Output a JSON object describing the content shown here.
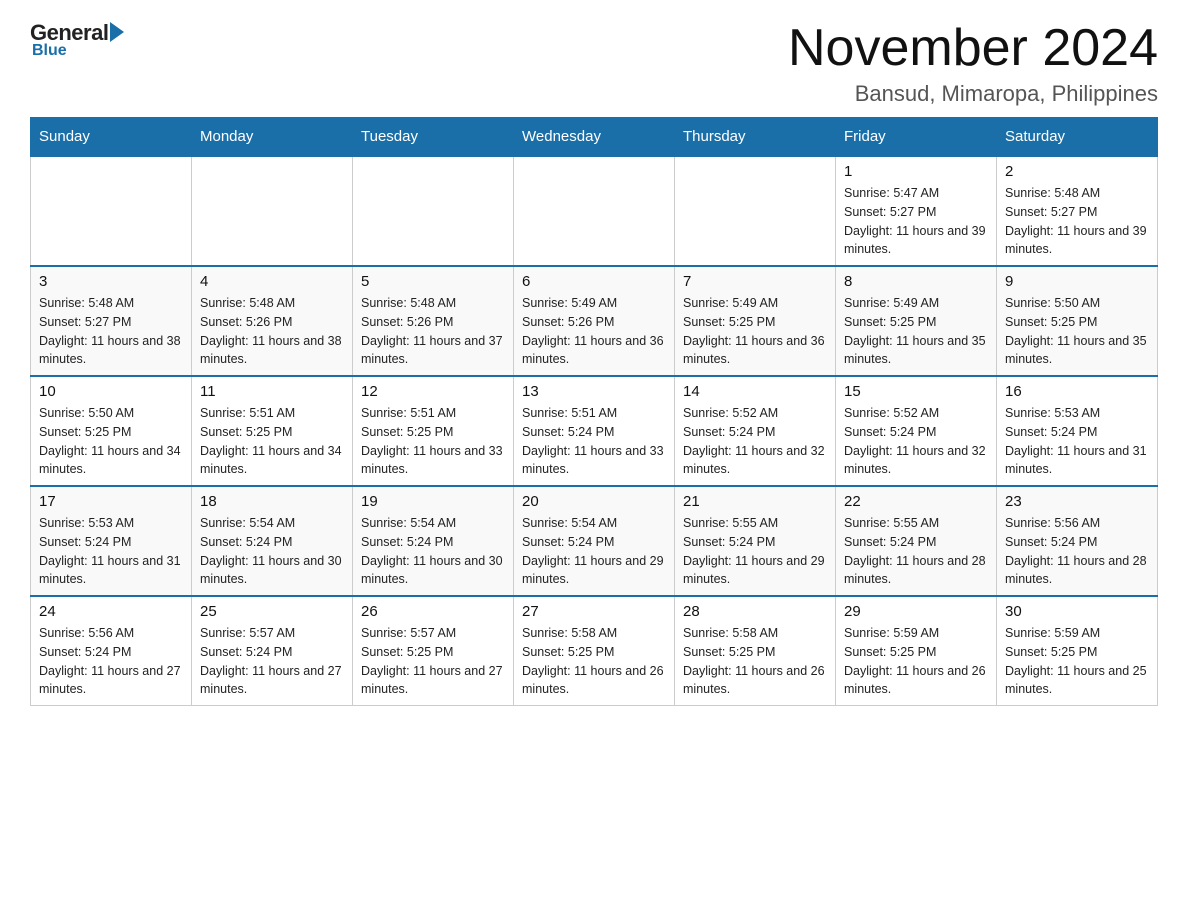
{
  "logo": {
    "general": "General",
    "blue": "Blue"
  },
  "title": "November 2024",
  "subtitle": "Bansud, Mimaropa, Philippines",
  "days_of_week": [
    "Sunday",
    "Monday",
    "Tuesday",
    "Wednesday",
    "Thursday",
    "Friday",
    "Saturday"
  ],
  "weeks": [
    [
      {
        "day": "",
        "info": ""
      },
      {
        "day": "",
        "info": ""
      },
      {
        "day": "",
        "info": ""
      },
      {
        "day": "",
        "info": ""
      },
      {
        "day": "",
        "info": ""
      },
      {
        "day": "1",
        "info": "Sunrise: 5:47 AM\nSunset: 5:27 PM\nDaylight: 11 hours and 39 minutes."
      },
      {
        "day": "2",
        "info": "Sunrise: 5:48 AM\nSunset: 5:27 PM\nDaylight: 11 hours and 39 minutes."
      }
    ],
    [
      {
        "day": "3",
        "info": "Sunrise: 5:48 AM\nSunset: 5:27 PM\nDaylight: 11 hours and 38 minutes."
      },
      {
        "day": "4",
        "info": "Sunrise: 5:48 AM\nSunset: 5:26 PM\nDaylight: 11 hours and 38 minutes."
      },
      {
        "day": "5",
        "info": "Sunrise: 5:48 AM\nSunset: 5:26 PM\nDaylight: 11 hours and 37 minutes."
      },
      {
        "day": "6",
        "info": "Sunrise: 5:49 AM\nSunset: 5:26 PM\nDaylight: 11 hours and 36 minutes."
      },
      {
        "day": "7",
        "info": "Sunrise: 5:49 AM\nSunset: 5:25 PM\nDaylight: 11 hours and 36 minutes."
      },
      {
        "day": "8",
        "info": "Sunrise: 5:49 AM\nSunset: 5:25 PM\nDaylight: 11 hours and 35 minutes."
      },
      {
        "day": "9",
        "info": "Sunrise: 5:50 AM\nSunset: 5:25 PM\nDaylight: 11 hours and 35 minutes."
      }
    ],
    [
      {
        "day": "10",
        "info": "Sunrise: 5:50 AM\nSunset: 5:25 PM\nDaylight: 11 hours and 34 minutes."
      },
      {
        "day": "11",
        "info": "Sunrise: 5:51 AM\nSunset: 5:25 PM\nDaylight: 11 hours and 34 minutes."
      },
      {
        "day": "12",
        "info": "Sunrise: 5:51 AM\nSunset: 5:25 PM\nDaylight: 11 hours and 33 minutes."
      },
      {
        "day": "13",
        "info": "Sunrise: 5:51 AM\nSunset: 5:24 PM\nDaylight: 11 hours and 33 minutes."
      },
      {
        "day": "14",
        "info": "Sunrise: 5:52 AM\nSunset: 5:24 PM\nDaylight: 11 hours and 32 minutes."
      },
      {
        "day": "15",
        "info": "Sunrise: 5:52 AM\nSunset: 5:24 PM\nDaylight: 11 hours and 32 minutes."
      },
      {
        "day": "16",
        "info": "Sunrise: 5:53 AM\nSunset: 5:24 PM\nDaylight: 11 hours and 31 minutes."
      }
    ],
    [
      {
        "day": "17",
        "info": "Sunrise: 5:53 AM\nSunset: 5:24 PM\nDaylight: 11 hours and 31 minutes."
      },
      {
        "day": "18",
        "info": "Sunrise: 5:54 AM\nSunset: 5:24 PM\nDaylight: 11 hours and 30 minutes."
      },
      {
        "day": "19",
        "info": "Sunrise: 5:54 AM\nSunset: 5:24 PM\nDaylight: 11 hours and 30 minutes."
      },
      {
        "day": "20",
        "info": "Sunrise: 5:54 AM\nSunset: 5:24 PM\nDaylight: 11 hours and 29 minutes."
      },
      {
        "day": "21",
        "info": "Sunrise: 5:55 AM\nSunset: 5:24 PM\nDaylight: 11 hours and 29 minutes."
      },
      {
        "day": "22",
        "info": "Sunrise: 5:55 AM\nSunset: 5:24 PM\nDaylight: 11 hours and 28 minutes."
      },
      {
        "day": "23",
        "info": "Sunrise: 5:56 AM\nSunset: 5:24 PM\nDaylight: 11 hours and 28 minutes."
      }
    ],
    [
      {
        "day": "24",
        "info": "Sunrise: 5:56 AM\nSunset: 5:24 PM\nDaylight: 11 hours and 27 minutes."
      },
      {
        "day": "25",
        "info": "Sunrise: 5:57 AM\nSunset: 5:24 PM\nDaylight: 11 hours and 27 minutes."
      },
      {
        "day": "26",
        "info": "Sunrise: 5:57 AM\nSunset: 5:25 PM\nDaylight: 11 hours and 27 minutes."
      },
      {
        "day": "27",
        "info": "Sunrise: 5:58 AM\nSunset: 5:25 PM\nDaylight: 11 hours and 26 minutes."
      },
      {
        "day": "28",
        "info": "Sunrise: 5:58 AM\nSunset: 5:25 PM\nDaylight: 11 hours and 26 minutes."
      },
      {
        "day": "29",
        "info": "Sunrise: 5:59 AM\nSunset: 5:25 PM\nDaylight: 11 hours and 26 minutes."
      },
      {
        "day": "30",
        "info": "Sunrise: 5:59 AM\nSunset: 5:25 PM\nDaylight: 11 hours and 25 minutes."
      }
    ]
  ]
}
